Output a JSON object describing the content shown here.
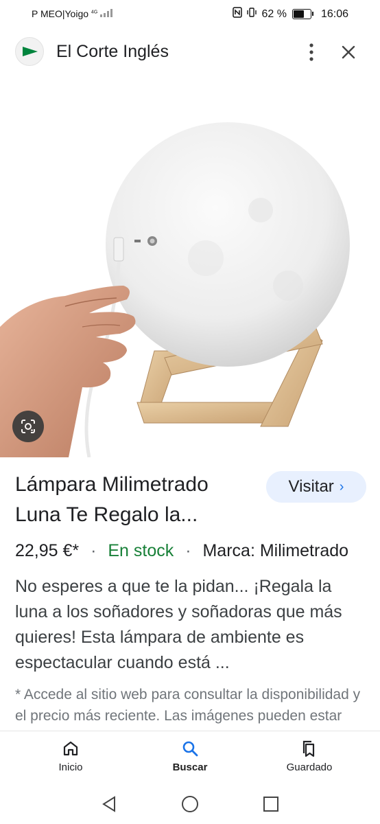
{
  "status_bar": {
    "carrier": "P MEO|Yoigo",
    "network": "4G",
    "battery": "62 %",
    "battery_level": 0.62,
    "time": "16:06"
  },
  "header": {
    "site_name": "El Corte Inglés",
    "brand_color": "#00843d"
  },
  "product": {
    "title": "Lámpara Milimetrado Luna Te Regalo la...",
    "visit_label": "Visitar",
    "price": "22,95 €*",
    "stock": "En stock",
    "brand": "Marca: Milimetrado",
    "description": "No esperes a que te la pidan... ¡Regala la luna a los soñadores y soñadoras que más quieres! Esta lámpara de ambiente es espectacular cuando está ...",
    "disclaimer": "* Accede al sitio web para consultar la disponibilidad y el precio más reciente. Las imágenes pueden estar protegidas por derechos"
  },
  "bottom_nav": {
    "items": [
      {
        "label": "Inicio",
        "icon": "home-icon"
      },
      {
        "label": "Buscar",
        "icon": "search-icon",
        "active": true
      },
      {
        "label": "Guardado",
        "icon": "saved-icon"
      }
    ]
  },
  "colors": {
    "accent": "#1a73e8",
    "stock_green": "#188038",
    "visit_bg": "#e8f0fe"
  }
}
